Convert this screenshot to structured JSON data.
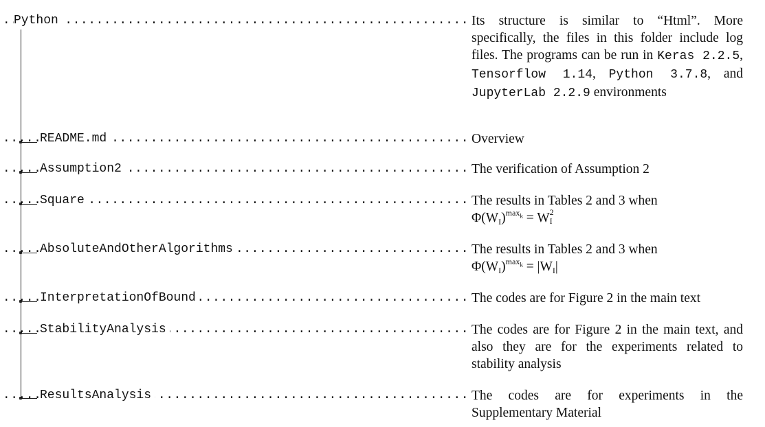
{
  "root": {
    "name": "Python",
    "description_parts": {
      "p1": "Its structure is similar to “Html”.  More specifically, the files in this folder include log files.  The programs can be run in ",
      "keras": "Keras 2.2.5",
      "sep1": ", ",
      "tensorflow": "Tensorflow 1.14",
      "sep2": ", ",
      "python": "Python 3.7.8",
      "sep3": ", and ",
      "jupyter": "JupyterLab 2.2.9",
      "p2": " environments"
    }
  },
  "entries": [
    {
      "name": "README.md",
      "description": "Overview"
    },
    {
      "name": "Assumption2",
      "description": "The verification of Assumption 2"
    },
    {
      "name": "Square",
      "description_text": "The results in Tables 2 and 3 when",
      "formula": {
        "phi": "Φ(W",
        "sub": "I",
        "close": ")",
        "sup": "max",
        "supsub": "k",
        "eq": " = W",
        "rsup": "2",
        "rsub": "I"
      }
    },
    {
      "name": "AbsoluteAndOtherAlgorithms",
      "description_text": "The results in Tables 2 and 3 when",
      "formula": {
        "phi": "Φ(W",
        "sub": "I",
        "close": ")",
        "sup": "max",
        "supsub": "k",
        "eq": " = |W",
        "rsub": "I",
        "end": "|"
      }
    },
    {
      "name": "InterpretationOfBound",
      "description": "The codes are for Figure 2 in the main text"
    },
    {
      "name": "StabilityAnalysis",
      "description": "The codes are for Figure 2 in the main text, and also they are for the experiments related to stability analysis"
    },
    {
      "name": "ResultsAnalysis",
      "description": "The codes are for experiments in the Supplementary Material"
    }
  ],
  "leader_dots": "..........................................................................................................................................."
}
